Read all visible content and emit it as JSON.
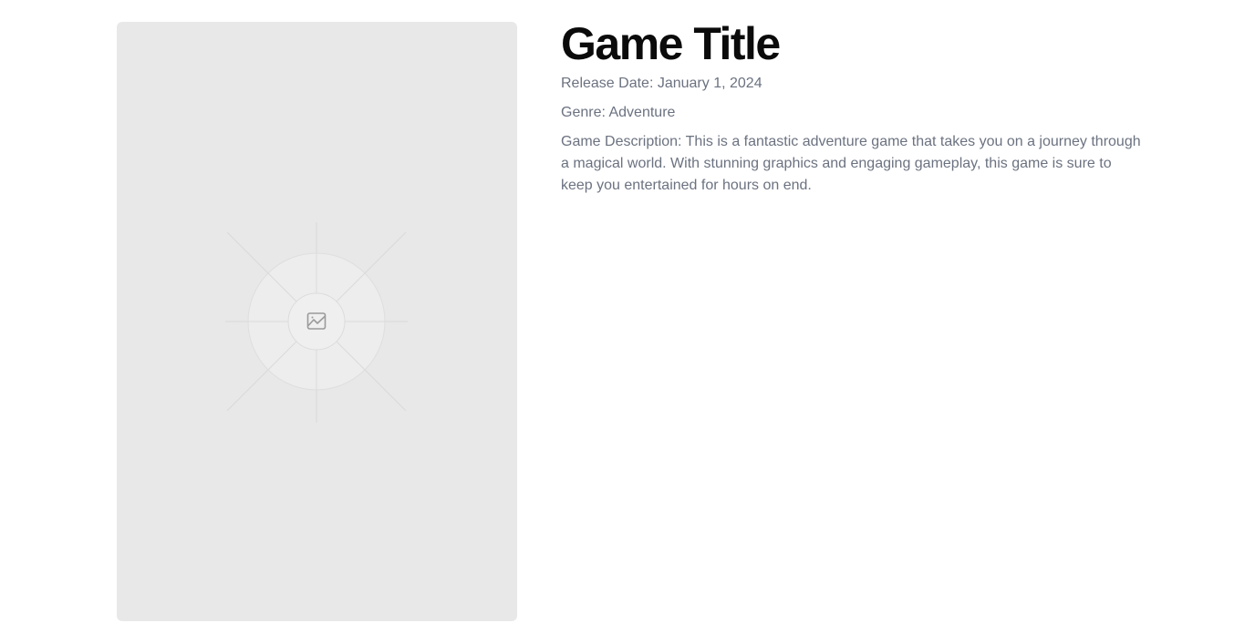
{
  "game": {
    "title": "Game Title",
    "release_date": "Release Date: January 1, 2024",
    "genre": "Genre: Adventure",
    "description": "Game Description: This is a fantastic adventure game that takes you on a journey through a magical world. With stunning graphics and engaging gameplay, this game is sure to keep you entertained for hours on end."
  },
  "cover": {
    "icon": "image-placeholder-icon",
    "background": "#e8e8e8"
  },
  "colors": {
    "title": "#0b0b0b",
    "text_muted": "#6b7280"
  }
}
